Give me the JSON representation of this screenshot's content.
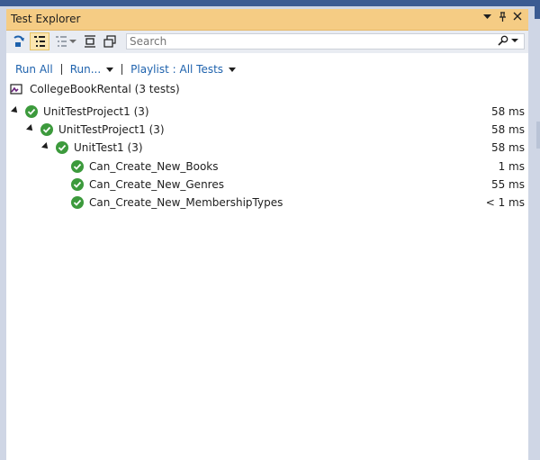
{
  "window": {
    "title": "Test Explorer"
  },
  "search": {
    "placeholder": "Search"
  },
  "commands": {
    "run_all": "Run All",
    "run": "Run...",
    "playlist": "Playlist : All Tests"
  },
  "solution": {
    "label": "CollegeBookRental (3 tests)"
  },
  "tree": [
    {
      "name": "UnitTestProject1 (3)",
      "duration": "58 ms"
    },
    {
      "name": "UnitTestProject1 (3)",
      "duration": "58 ms"
    },
    {
      "name": "UnitTest1 (3)",
      "duration": "58 ms"
    },
    {
      "name": "Can_Create_New_Books",
      "duration": "1 ms"
    },
    {
      "name": "Can_Create_New_Genres",
      "duration": "55 ms"
    },
    {
      "name": "Can_Create_New_MembershipTypes",
      "duration": "< 1 ms"
    }
  ],
  "colors": {
    "title_bar": "#f5cc84",
    "pass": "#3c9a3c",
    "link": "#1e62ad"
  }
}
